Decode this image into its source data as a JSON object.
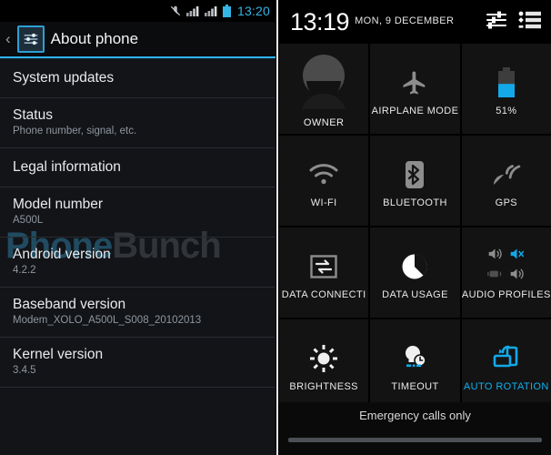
{
  "left_panel": {
    "status_bar": {
      "clock": "13:20",
      "icons": [
        "vibrate-mute-icon",
        "signal-bars-icon",
        "signal-bars-icon",
        "battery-icon"
      ],
      "clock_color": "#33b5e5"
    },
    "action_bar": {
      "back_label": "‹",
      "app_icon": "settings-sliders-icon",
      "title": "About phone",
      "accent_color": "#2fb2e8"
    },
    "watermark": {
      "part_a": "Phone",
      "part_b": "Bunch"
    },
    "items": [
      {
        "title": "System updates",
        "sub": ""
      },
      {
        "title": "Status",
        "sub": "Phone number, signal, etc."
      },
      {
        "title": "Legal information",
        "sub": ""
      },
      {
        "title": "Model number",
        "sub": "A500L"
      },
      {
        "title": "Android version",
        "sub": "4.2.2"
      },
      {
        "title": "Baseband version",
        "sub": "Modem_XOLO_A500L_S008_20102013"
      },
      {
        "title": "Kernel version",
        "sub": "3.4.5"
      }
    ]
  },
  "right_panel": {
    "header": {
      "time": "13:19",
      "date": "MON, 9 DECEMBER",
      "icons": [
        "sliders-settings-icon",
        "list-view-icon"
      ]
    },
    "tiles": [
      {
        "label": "OWNER",
        "icon": "user-avatar-icon",
        "active": false
      },
      {
        "label": "AIRPLANE MODE",
        "icon": "airplane-icon",
        "active": false
      },
      {
        "label": "51%",
        "icon": "battery-icon",
        "active": false
      },
      {
        "label": "WI-FI",
        "icon": "wifi-icon",
        "active": false
      },
      {
        "label": "BLUETOOTH",
        "icon": "bluetooth-icon",
        "active": false
      },
      {
        "label": "GPS",
        "icon": "gps-satellite-icon",
        "active": false
      },
      {
        "label": "DATA CONNECTI",
        "icon": "data-transfer-icon",
        "active": false
      },
      {
        "label": "DATA USAGE",
        "icon": "pie-chart-icon",
        "active": false
      },
      {
        "label": "AUDIO PROFILES",
        "icon": "speaker-profiles-icon",
        "active": false
      },
      {
        "label": "BRIGHTNESS",
        "icon": "sun-brightness-icon",
        "active": false
      },
      {
        "label": "TIMEOUT",
        "icon": "lightbulb-clock-icon",
        "active": false
      },
      {
        "label": "AUTO ROTATION",
        "icon": "auto-rotate-icon",
        "active": true
      }
    ],
    "footer": {
      "status_text": "Emergency calls only"
    },
    "accent_color": "#0fb0f0"
  }
}
